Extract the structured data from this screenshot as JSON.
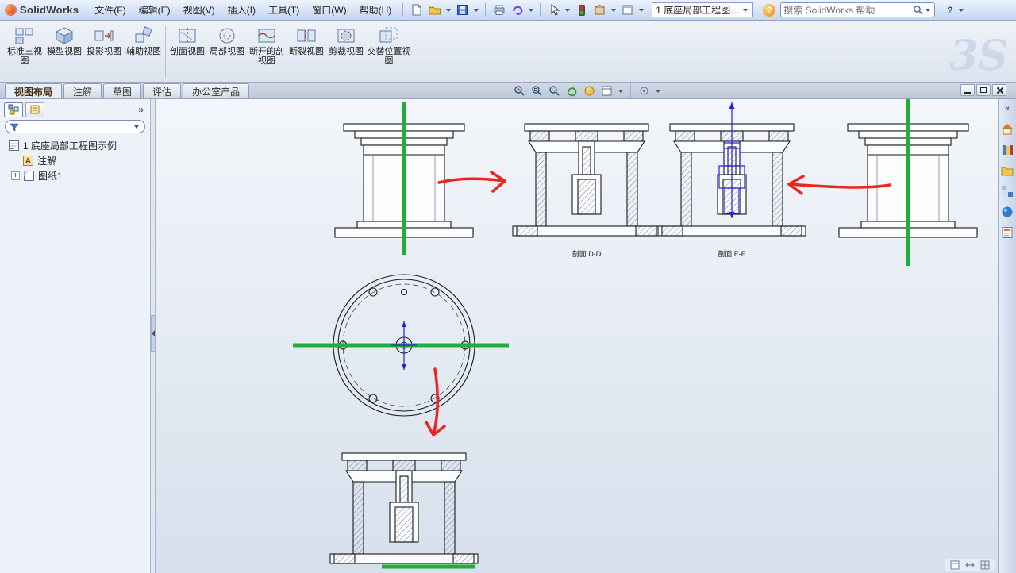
{
  "colors": {
    "green_line": "#22ac38",
    "red_arrow": "#e8281e",
    "blue_mark": "#2222dd",
    "drawing_line": "#1a1a1a"
  },
  "titlebar": {
    "app_name": "SolidWorks",
    "menus": [
      "文件(F)",
      "编辑(E)",
      "视图(V)",
      "插入(I)",
      "工具(T)",
      "窗口(W)",
      "帮助(H)"
    ],
    "doc_combo": "1 底座局部工程图…",
    "search_placeholder": "搜索 SolidWorks 帮助",
    "help_label": "?"
  },
  "ribbon": {
    "buttons": [
      "标准三视图",
      "模型视图",
      "投影视图",
      "辅助视图",
      "剖面视图",
      "局部视图",
      "断开的剖视图",
      "断裂视图",
      "剪裁视图",
      "交替位置视图"
    ],
    "watermark": "3S"
  },
  "tabs": [
    "视图布局",
    "注解",
    "草图",
    "评估",
    "办公室产品"
  ],
  "feature_tree": {
    "root": "1 底座局部工程图示例",
    "annotations": "注解",
    "sheet": "图纸1"
  },
  "canvas": {
    "section_d_label": "剖面 D-D",
    "section_e_label": "剖面 E-E"
  },
  "glyphs": {
    "question": "?",
    "chevrons_right": "»",
    "chevrons_left": "«",
    "plus": "+",
    "annotation_letter": "A"
  }
}
